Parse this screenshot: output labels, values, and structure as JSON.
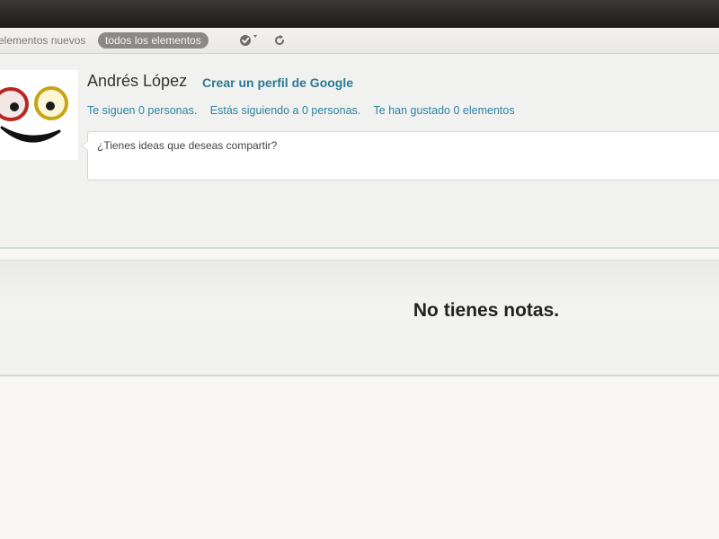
{
  "toolbar": {
    "filter_new_label": "elementos nuevos",
    "filter_all_label": "todos los elementos",
    "mark_read_icon": "check-circle-icon",
    "refresh_icon": "refresh-icon"
  },
  "profile": {
    "name": "Andrés López",
    "create_profile_link": "Crear un perfil de Google",
    "followers": "Te siguen 0 personas.",
    "following": "Estás siguiendo a 0 personas.",
    "liked": "Te han gustado 0 elementos",
    "avatar_icon": "smiley-face-icon"
  },
  "share": {
    "placeholder": "¿Tienes ideas que deseas compartir?"
  },
  "notes": {
    "empty_message": "No tienes notas."
  },
  "colors": {
    "link": "#2a86a4",
    "active_pill": "#8a8985",
    "topbar": "#1d1c1b"
  }
}
